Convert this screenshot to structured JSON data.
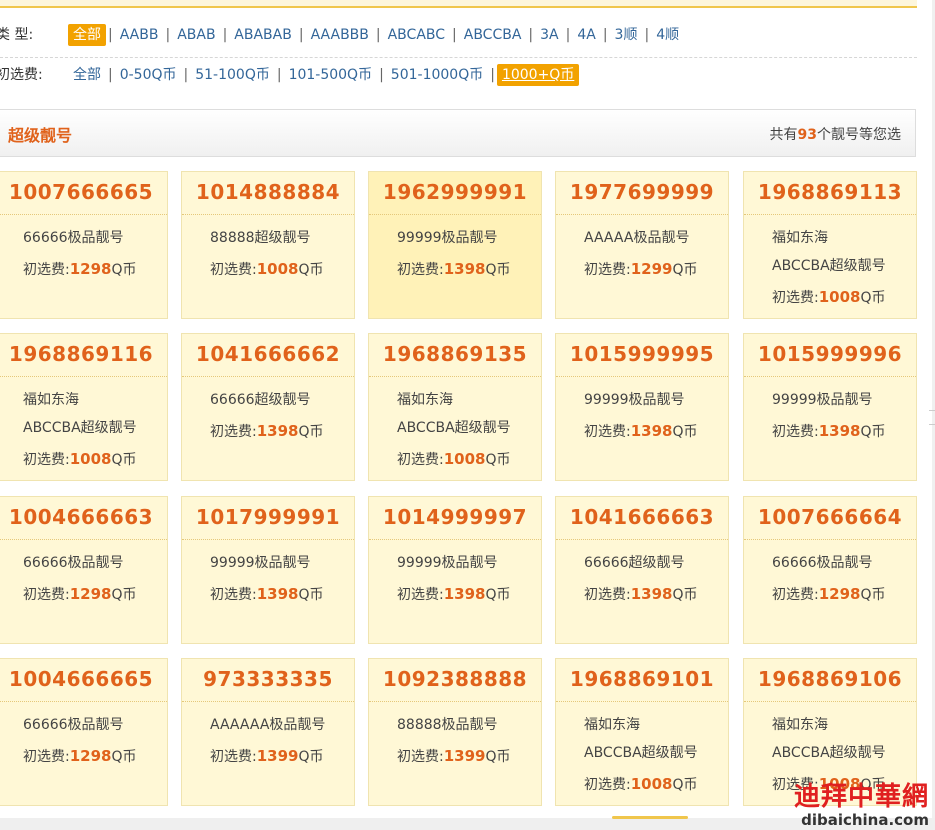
{
  "filters": {
    "type": {
      "label": "类  型:",
      "options": [
        {
          "label": "全部",
          "active": true
        },
        {
          "label": "AABB"
        },
        {
          "label": "ABAB"
        },
        {
          "label": "ABABAB"
        },
        {
          "label": "AAABBB"
        },
        {
          "label": "ABCABC"
        },
        {
          "label": "ABCCBA"
        },
        {
          "label": "3A"
        },
        {
          "label": "4A"
        },
        {
          "label": "3顺"
        },
        {
          "label": "4顺"
        }
      ]
    },
    "fee": {
      "label": "初选费:",
      "options": [
        {
          "label": "全部"
        },
        {
          "label": "0-50Q币"
        },
        {
          "label": "51-100Q币"
        },
        {
          "label": "101-500Q币"
        },
        {
          "label": "501-1000Q币"
        },
        {
          "label": "1000+Q币",
          "active": true
        }
      ]
    }
  },
  "panel": {
    "title": "超级靓号",
    "count_prefix": "共有",
    "count": "93",
    "count_suffix": "个靓号等您选"
  },
  "fee_prefix": "初选费:",
  "fee_unit": "Q币",
  "cards": [
    {
      "number": "1007666665",
      "lines": [
        "66666极品靓号"
      ],
      "fee": "1298"
    },
    {
      "number": "1014888884",
      "lines": [
        "88888超级靓号"
      ],
      "fee": "1008"
    },
    {
      "number": "1962999991",
      "lines": [
        "99999极品靓号"
      ],
      "fee": "1398",
      "highlight": true
    },
    {
      "number": "1977699999",
      "lines": [
        "AAAAA极品靓号"
      ],
      "fee": "1299"
    },
    {
      "number": "1968869113",
      "lines": [
        "福如东海",
        "ABCCBA超级靓号"
      ],
      "fee": "1008"
    },
    {
      "number": "1968869116",
      "lines": [
        "福如东海",
        "ABCCBA超级靓号"
      ],
      "fee": "1008"
    },
    {
      "number": "1041666662",
      "lines": [
        "66666超级靓号"
      ],
      "fee": "1398"
    },
    {
      "number": "1968869135",
      "lines": [
        "福如东海",
        "ABCCBA超级靓号"
      ],
      "fee": "1008"
    },
    {
      "number": "1015999995",
      "lines": [
        "99999极品靓号"
      ],
      "fee": "1398"
    },
    {
      "number": "1015999996",
      "lines": [
        "99999极品靓号"
      ],
      "fee": "1398"
    },
    {
      "number": "1004666663",
      "lines": [
        "66666极品靓号"
      ],
      "fee": "1298"
    },
    {
      "number": "1017999991",
      "lines": [
        "99999极品靓号"
      ],
      "fee": "1398"
    },
    {
      "number": "1014999997",
      "lines": [
        "99999极品靓号"
      ],
      "fee": "1398"
    },
    {
      "number": "1041666663",
      "lines": [
        "66666超级靓号"
      ],
      "fee": "1398"
    },
    {
      "number": "1007666664",
      "lines": [
        "66666极品靓号"
      ],
      "fee": "1298"
    },
    {
      "number": "1004666665",
      "lines": [
        "66666极品靓号"
      ],
      "fee": "1298"
    },
    {
      "number": "973333335",
      "lines": [
        "AAAAAA极品靓号"
      ],
      "fee": "1399"
    },
    {
      "number": "1092388888",
      "lines": [
        "88888极品靓号"
      ],
      "fee": "1399"
    },
    {
      "number": "1968869101",
      "lines": [
        "福如东海",
        "ABCCBA超级靓号"
      ],
      "fee": "1008"
    },
    {
      "number": "1968869106",
      "lines": [
        "福如东海",
        "ABCCBA超级靓号"
      ],
      "fee": "1008"
    }
  ],
  "watermark": {
    "cn": "迪拜中華網",
    "en": "dibaichina.com"
  }
}
